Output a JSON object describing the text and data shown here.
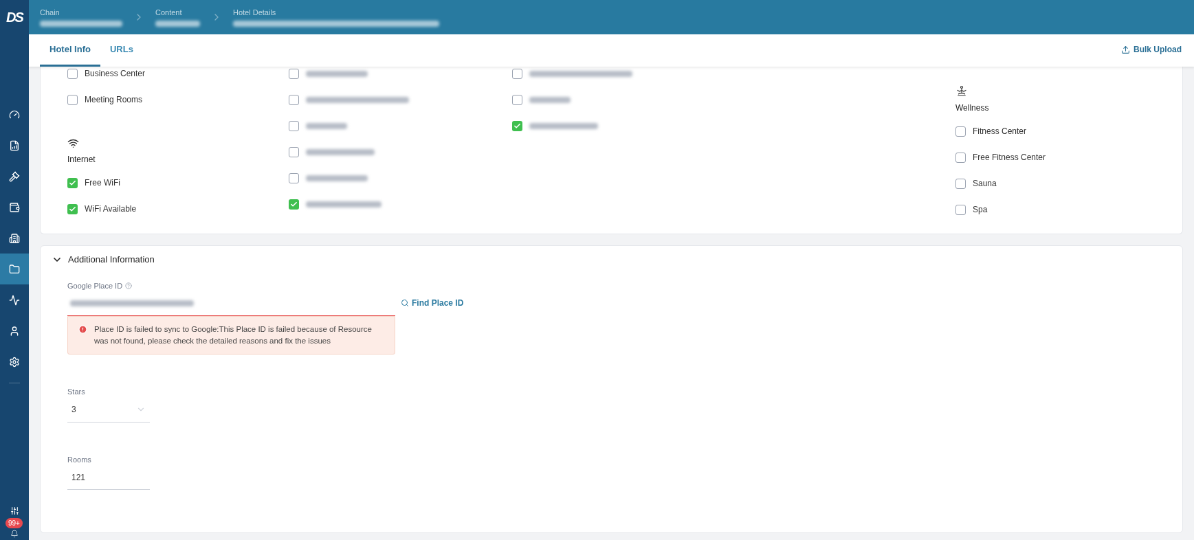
{
  "header": {
    "logo": "DS",
    "breadcrumbs": [
      {
        "label": "Chain"
      },
      {
        "label": "Content"
      },
      {
        "label": "Hotel Details"
      }
    ]
  },
  "sidebar": {
    "items": [
      {
        "selected": false
      },
      {
        "selected": false
      },
      {
        "selected": false
      },
      {
        "selected": false
      },
      {
        "selected": false
      },
      {
        "selected": true
      },
      {
        "selected": false
      },
      {
        "selected": false
      },
      {
        "selected": false
      }
    ],
    "notification_badge": "99+"
  },
  "tabs": [
    {
      "label": "Hotel Info",
      "selected": true
    },
    {
      "label": "URLs",
      "selected": false
    }
  ],
  "bulk_upload": "Bulk Upload",
  "amenities": {
    "columns": [
      {
        "entries": [
          {
            "kind": "checkbox",
            "label": "Business Center",
            "checked": false
          },
          {
            "kind": "checkbox",
            "label": "Meeting Rooms",
            "checked": false
          },
          {
            "kind": "heading",
            "label": "Internet"
          },
          {
            "kind": "checkbox",
            "label": "Free WiFi",
            "checked": true
          },
          {
            "kind": "checkbox",
            "label": "WiFi Available",
            "checked": true
          }
        ]
      },
      {
        "entries": [
          {
            "kind": "blurred",
            "checked": false
          },
          {
            "kind": "blurred",
            "checked": false
          },
          {
            "kind": "blurred",
            "checked": false
          },
          {
            "kind": "blurred",
            "checked": false
          },
          {
            "kind": "blurred",
            "checked": false
          },
          {
            "kind": "blurred",
            "checked": true
          }
        ]
      },
      {
        "entries": [
          {
            "kind": "blurred",
            "checked": false
          },
          {
            "kind": "blurred",
            "checked": false
          },
          {
            "kind": "blurred",
            "checked": true
          }
        ]
      },
      {
        "entries": [
          {
            "kind": "heading",
            "label": "Wellness"
          },
          {
            "kind": "checkbox",
            "label": "Fitness Center",
            "checked": false
          },
          {
            "kind": "checkbox",
            "label": "Free Fitness Center",
            "checked": false
          },
          {
            "kind": "checkbox",
            "label": "Sauna",
            "checked": false
          },
          {
            "kind": "checkbox",
            "label": "Spa",
            "checked": false
          }
        ]
      }
    ]
  },
  "additional_information": {
    "title": "Additional Information",
    "expanded": true,
    "google_place_id": {
      "label": "Google Place ID"
    },
    "find_place_id": "Find Place ID",
    "error": "Place ID is failed to sync to Google:This Place ID is failed because of Resource was not found, please check the detailed reasons and fix the issues",
    "stars": {
      "label": "Stars",
      "value": "3"
    },
    "rooms": {
      "label": "Rooms",
      "value": "121"
    }
  }
}
